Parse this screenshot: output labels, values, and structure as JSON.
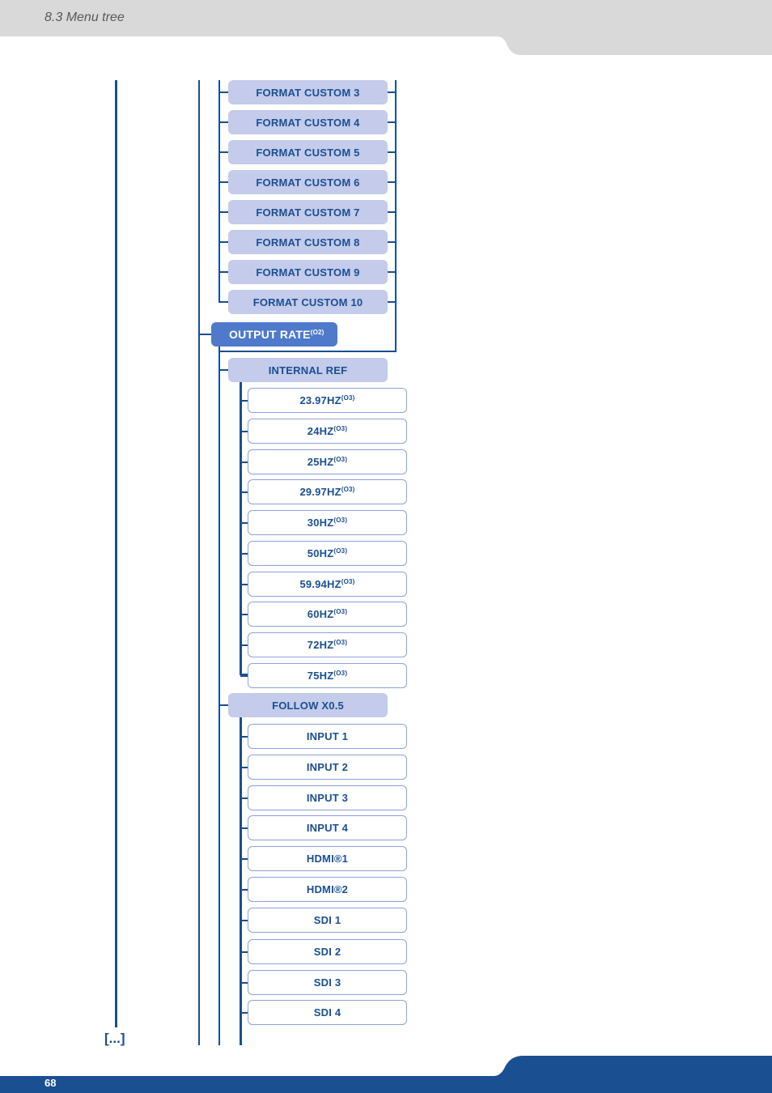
{
  "header": {
    "section_title": "8.3 Menu tree"
  },
  "footer": {
    "page_number": "68"
  },
  "colors": {
    "brand_blue": "#1a4f91",
    "level1_fill": "#4f7acb",
    "level2_fill": "#c4cbeb",
    "level3_border": "#8ea2dc",
    "header_gray": "#d9d9d9"
  },
  "tree": {
    "format_custom_items": [
      "FORMAT CUSTOM 3",
      "FORMAT CUSTOM 4",
      "FORMAT CUSTOM 5",
      "FORMAT CUSTOM 6",
      "FORMAT CUSTOM 7",
      "FORMAT CUSTOM 8",
      "FORMAT CUSTOM 9",
      "FORMAT CUSTOM 10"
    ],
    "output_rate": {
      "label": "OUTPUT RATE",
      "note": "(O2)"
    },
    "internal_ref": {
      "label": "INTERNAL REF",
      "items": [
        {
          "label": "23.97HZ",
          "note": "(O3)"
        },
        {
          "label": "24HZ",
          "note": "(O3)"
        },
        {
          "label": "25HZ",
          "note": "(O3)"
        },
        {
          "label": "29.97HZ",
          "note": "(O3)"
        },
        {
          "label": "30HZ",
          "note": "(O3)"
        },
        {
          "label": "50HZ",
          "note": "(O3)"
        },
        {
          "label": "59.94HZ",
          "note": "(O3)"
        },
        {
          "label": "60HZ",
          "note": "(O3)"
        },
        {
          "label": "72HZ",
          "note": "(O3)"
        },
        {
          "label": "75HZ",
          "note": "(O3)"
        }
      ]
    },
    "follow": {
      "label": "FOLLOW X0.5",
      "items": [
        "INPUT 1",
        "INPUT 2",
        "INPUT 3",
        "INPUT 4",
        "HDMI®1",
        "HDMI®2",
        "SDI 1",
        "SDI 2",
        "SDI 3",
        "SDI 4"
      ]
    },
    "continuation": "[...]"
  }
}
